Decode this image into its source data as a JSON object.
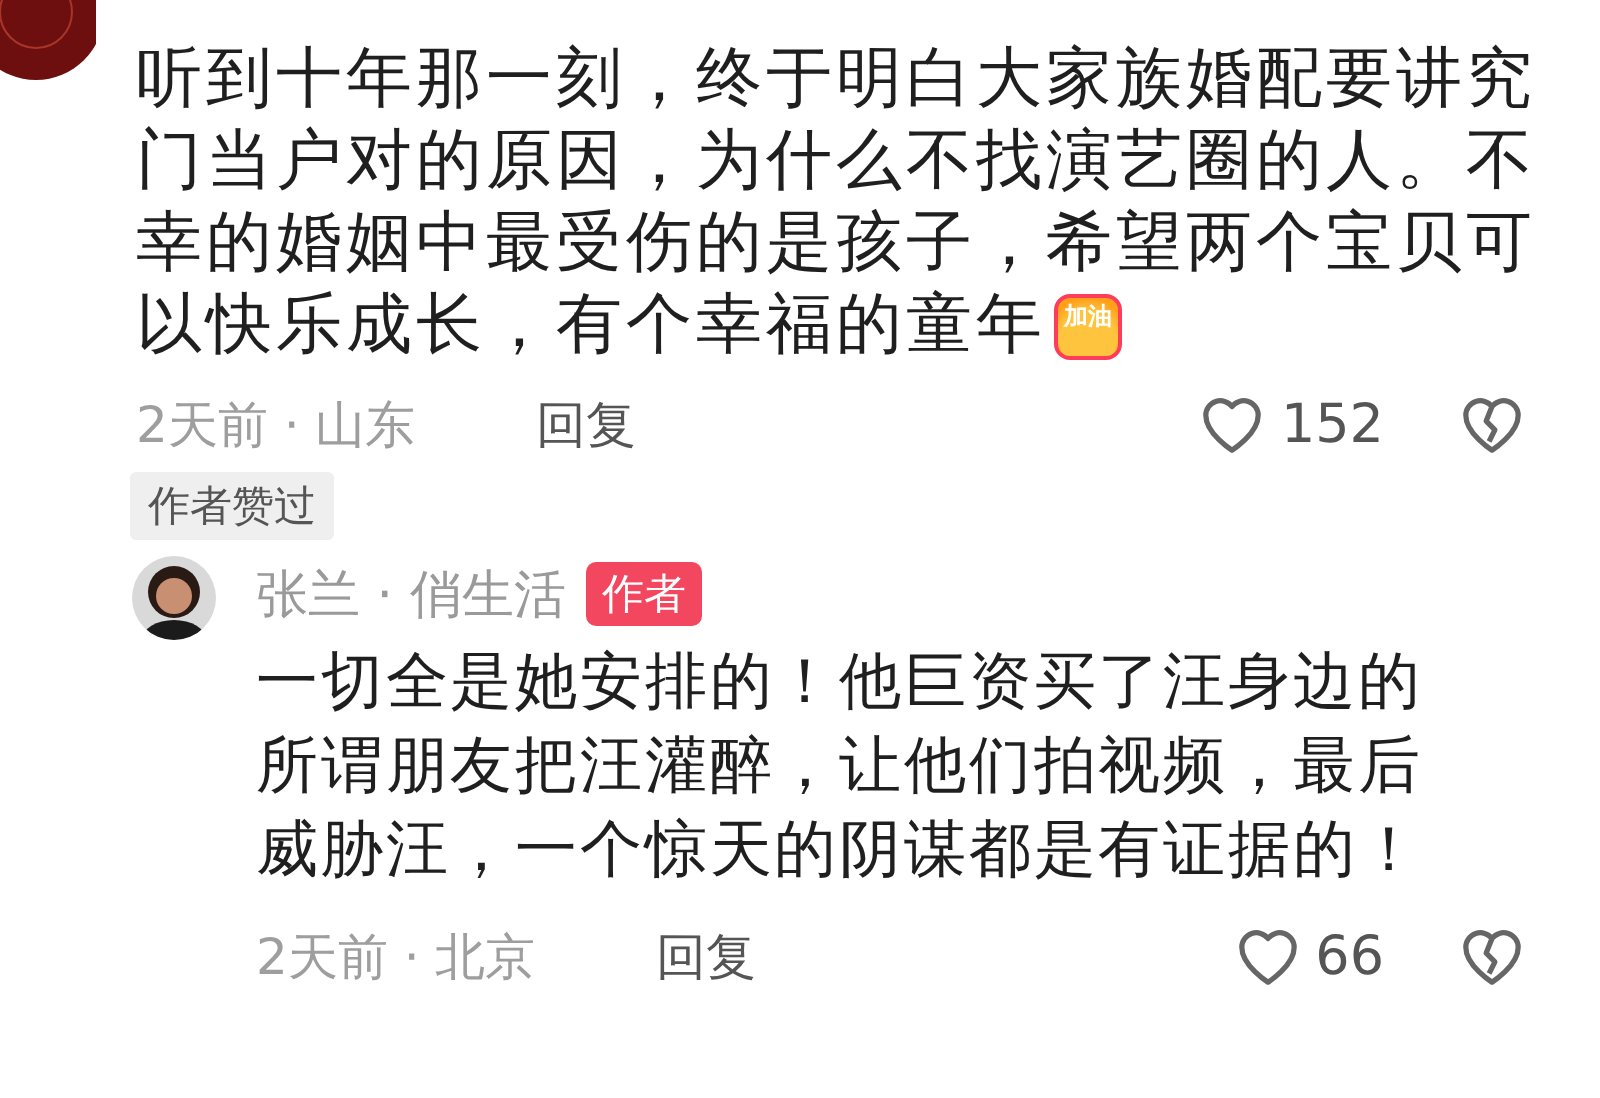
{
  "comments": [
    {
      "kind": "cut",
      "text": "听到十年那一刻，终于明白大家族婚配要讲究门当户对的原因，为什么不找演艺圈的人。不幸的婚姻中最受伤的是孩子，希望两个宝贝可以快乐成长，有个幸福的童年",
      "sticker": "加油",
      "meta": "2天前 · 山东",
      "reply": "回复",
      "likes": "152",
      "liked_by_author": "作者赞过"
    },
    {
      "kind": "full",
      "name": "张兰 · 俏生活",
      "author_tag": "作者",
      "text": "一切全是她安排的！他巨资买了汪身边的所谓朋友把汪灌醉，让他们拍视频，最后威胁汪，一个惊天的阴谋都是有证据的！",
      "meta": "2天前 · 北京",
      "reply": "回复",
      "likes": "66"
    }
  ]
}
